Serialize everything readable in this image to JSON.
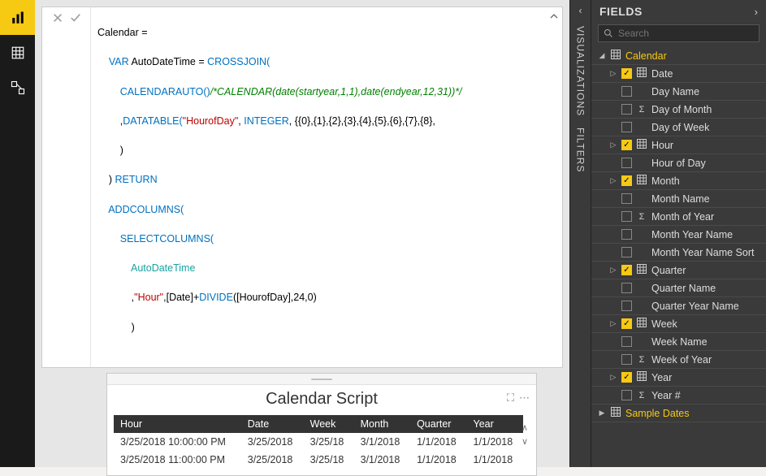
{
  "nav": {
    "items": [
      "report-view",
      "data-view",
      "model-view"
    ],
    "active": 0
  },
  "formula": {
    "line1": "Calendar =",
    "var": "    VAR",
    "varname": " AutoDateTime = ",
    "cross": "CROSSJOIN(",
    "calauto": "        CALENDARAUTO()",
    "comment": "/*CALENDAR(date(startyear,1,1),date(endyear,12,31))*/",
    "dt1": "        ,",
    "dtfn": "DATATABLE(",
    "dtstr": "\"HourofDay\"",
    "dtcomma": ", ",
    "dttype": "INTEGER",
    "dtrest": ", {{0},{1},{2},{3},{4},{5},{6},{7},{8},",
    "close1": "        )",
    "ret1": "    ) ",
    "return": "RETURN",
    "add": "    ADDCOLUMNS(",
    "sel": "        SELECTCOLUMNS(",
    "auto": "            AutoDateTime",
    "hourline1": "            ,",
    "hourstr": "\"Hour\"",
    "hourline2": ",[Date]+",
    "divide": "DIVIDE",
    "hourline3": "([HourofDay],24,0)",
    "close2": "            )"
  },
  "visual": {
    "title": "Calendar Script",
    "columns": [
      "Hour",
      "Date",
      "Week",
      "Month",
      "Quarter",
      "Year"
    ],
    "rows": [
      [
        "3/25/2018 10:00:00 PM",
        "3/25/2018",
        "3/25/18",
        "3/1/2018",
        "1/1/2018",
        "1/1/2018"
      ],
      [
        "3/25/2018 11:00:00 PM",
        "3/25/2018",
        "3/25/18",
        "3/1/2018",
        "1/1/2018",
        "1/1/2018"
      ]
    ]
  },
  "panels": {
    "viz": "VISUALIZATIONS",
    "filters": "FILTERS",
    "fields_title": "FIELDS",
    "search_placeholder": "Search"
  },
  "fields": {
    "tables": [
      {
        "name": "Calendar",
        "expanded": true,
        "columns": [
          {
            "label": "Date",
            "checked": true,
            "icon": "table",
            "expandable": true
          },
          {
            "label": "Day Name",
            "checked": false,
            "icon": "",
            "indent": true
          },
          {
            "label": "Day of Month",
            "checked": false,
            "icon": "sigma",
            "indent": true
          },
          {
            "label": "Day of Week",
            "checked": false,
            "icon": "",
            "indent": true
          },
          {
            "label": "Hour",
            "checked": true,
            "icon": "table",
            "expandable": true
          },
          {
            "label": "Hour of Day",
            "checked": false,
            "icon": "",
            "indent": true
          },
          {
            "label": "Month",
            "checked": true,
            "icon": "table",
            "expandable": true
          },
          {
            "label": "Month Name",
            "checked": false,
            "icon": "",
            "indent": true
          },
          {
            "label": "Month of Year",
            "checked": false,
            "icon": "sigma",
            "indent": true
          },
          {
            "label": "Month Year Name",
            "checked": false,
            "icon": "",
            "indent": true
          },
          {
            "label": "Month Year Name Sort",
            "checked": false,
            "icon": "",
            "indent": true
          },
          {
            "label": "Quarter",
            "checked": true,
            "icon": "table",
            "expandable": true
          },
          {
            "label": "Quarter Name",
            "checked": false,
            "icon": "",
            "indent": true
          },
          {
            "label": "Quarter Year Name",
            "checked": false,
            "icon": "",
            "indent": true
          },
          {
            "label": "Week",
            "checked": true,
            "icon": "table",
            "expandable": true
          },
          {
            "label": "Week Name",
            "checked": false,
            "icon": "",
            "indent": true
          },
          {
            "label": "Week of Year",
            "checked": false,
            "icon": "sigma",
            "indent": true
          },
          {
            "label": "Year",
            "checked": true,
            "icon": "table",
            "expandable": true
          },
          {
            "label": "Year #",
            "checked": false,
            "icon": "sigma",
            "indent": true
          }
        ]
      },
      {
        "name": "Sample Dates",
        "expanded": false,
        "columns": []
      }
    ]
  }
}
